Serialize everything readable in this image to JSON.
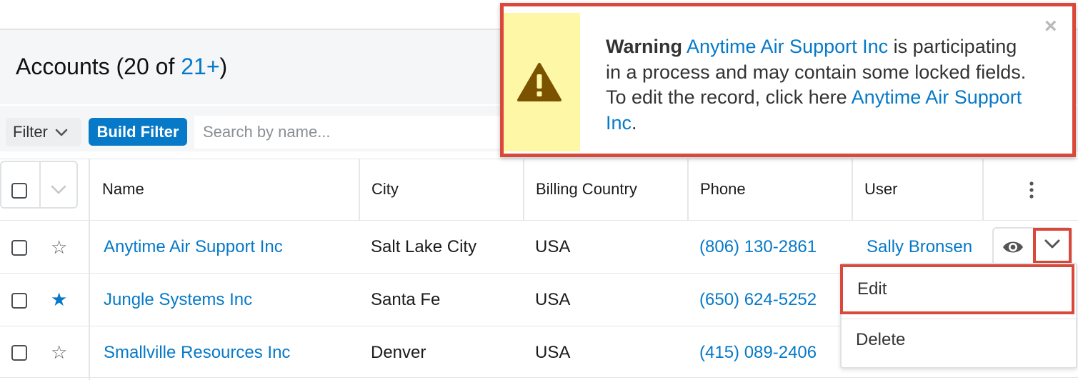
{
  "header": {
    "title_prefix": "Accounts (20 of ",
    "title_count_link": "21+",
    "title_suffix": ")"
  },
  "filter_bar": {
    "filter_label": "Filter",
    "build_filter_label": "Build Filter",
    "search_placeholder": "Search by name..."
  },
  "table": {
    "columns": [
      "Name",
      "City",
      "Billing Country",
      "Phone",
      "User"
    ],
    "rows": [
      {
        "name": "Anytime Air Support Inc",
        "city": "Salt Lake City",
        "country": "USA",
        "phone": "(806) 130-2861",
        "user": "Sally Bronsen",
        "favorite": false
      },
      {
        "name": "Jungle Systems Inc",
        "city": "Santa Fe",
        "country": "USA",
        "phone": "(650) 624-5252",
        "user": "",
        "favorite": true
      },
      {
        "name": "Smallville Resources Inc",
        "city": "Denver",
        "country": "USA",
        "phone": "(415) 089-2406",
        "user": "",
        "favorite": false
      }
    ]
  },
  "row_menu": {
    "items": [
      "Edit",
      "Delete"
    ]
  },
  "alert": {
    "label": "Warning",
    "record_link": "Anytime Air Support Inc",
    "message_mid": " is participating in a process and may contain some locked fields. To edit the record, click here ",
    "edit_link": "Anytime Air Support Inc",
    "message_end": ".",
    "close_glyph": "×"
  },
  "colors": {
    "accent_blue": "#0679c8",
    "highlight_red": "#d9483b",
    "warning_yellow": "#fdf7a6",
    "warning_icon": "#7a5200",
    "favorite_star": "#0679c8"
  },
  "icons": {
    "filter_chevron": "chevron-down-icon",
    "favorite": "star-icon",
    "preview": "eye-icon",
    "row_actions": "chevron-down-icon",
    "column_menu": "vertical-dots-icon",
    "warning": "warning-triangle-icon",
    "close": "close-icon"
  }
}
